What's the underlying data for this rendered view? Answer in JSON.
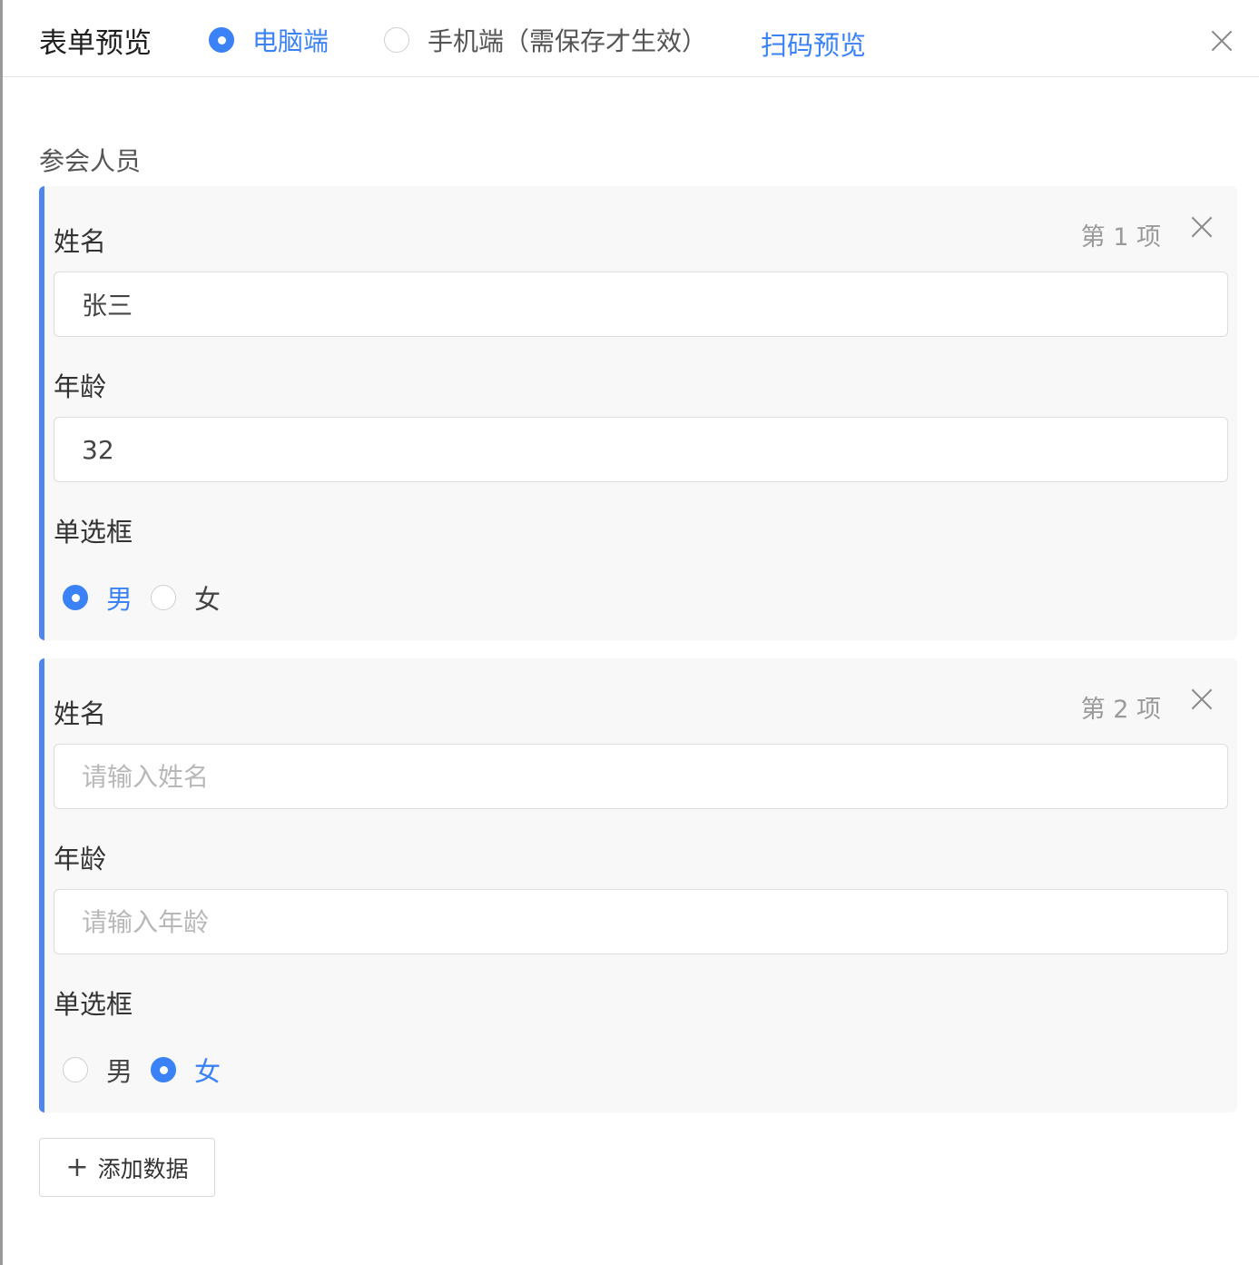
{
  "header": {
    "title": "表单预览",
    "modes": [
      {
        "label": "电脑端",
        "checked": true
      },
      {
        "label": "手机端（需保存才生效）",
        "checked": false
      }
    ],
    "scan_link": "扫码预览"
  },
  "section": {
    "label": "参会人员"
  },
  "groups": [
    {
      "index_label": "第 1 项",
      "name": {
        "label": "姓名",
        "value": "张三",
        "placeholder": "请输入姓名"
      },
      "age": {
        "label": "年龄",
        "value": "32",
        "placeholder": "请输入年龄"
      },
      "radio": {
        "label": "单选框",
        "options": [
          "男",
          "女"
        ],
        "selected": "男"
      }
    },
    {
      "index_label": "第 2 项",
      "name": {
        "label": "姓名",
        "value": "",
        "placeholder": "请输入姓名"
      },
      "age": {
        "label": "年龄",
        "value": "",
        "placeholder": "请输入年龄"
      },
      "radio": {
        "label": "单选框",
        "options": [
          "男",
          "女"
        ],
        "selected": "女"
      }
    }
  ],
  "add_button": {
    "icon": "plus-icon",
    "label": "添加数据"
  },
  "colors": {
    "accent": "#3b82f6",
    "group_border": "#4f86ec",
    "group_bg": "#f8f8f8"
  }
}
